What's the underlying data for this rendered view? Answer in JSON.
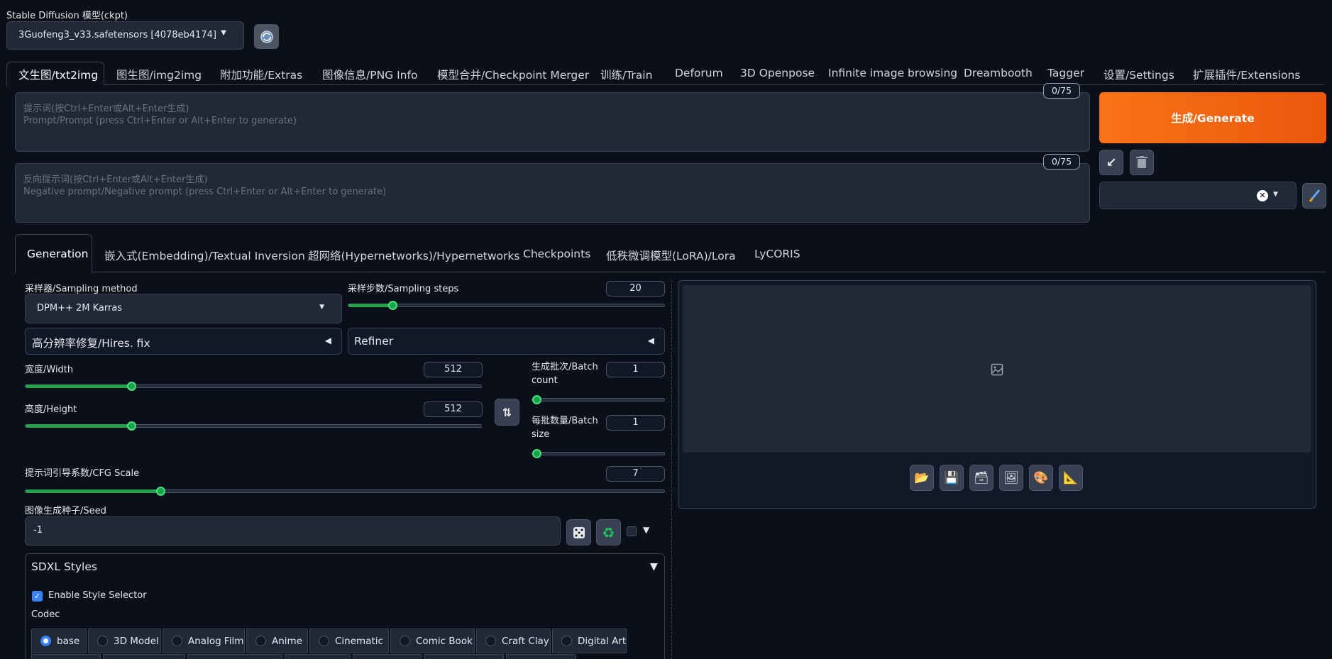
{
  "model": {
    "label": "Stable Diffusion 模型(ckpt)",
    "selected": "3Guofeng3_v33.safetensors [4078eb4174]"
  },
  "tabs": [
    "文生图/txt2img",
    "图生图/img2img",
    "附加功能/Extras",
    "图像信息/PNG Info",
    "模型合并/Checkpoint Merger",
    "训练/Train",
    "Deforum",
    "3D Openpose",
    "Infinite image browsing",
    "Dreambooth",
    "Tagger",
    "设置/Settings",
    "扩展插件/Extensions"
  ],
  "prompt": {
    "placeholder_line1": "提示词(按Ctrl+Enter或Alt+Enter生成)",
    "placeholder_line2": "Prompt/Prompt (press Ctrl+Enter or Alt+Enter to generate)",
    "token_count": "0/75"
  },
  "negative_prompt": {
    "placeholder_line1": "反向提示词(按Ctrl+Enter或Alt+Enter生成)",
    "placeholder_line2": "Negative prompt/Negative prompt (press Ctrl+Enter or Alt+Enter to generate)",
    "token_count": "0/75"
  },
  "generate_label": "生成/Generate",
  "subtabs": [
    "Generation",
    "嵌入式(Embedding)/Textual Inversion",
    "超网络(Hypernetworks)/Hypernetworks",
    "Checkpoints",
    "低秩微调模型(LoRA)/Lora",
    "LyCORIS"
  ],
  "sampler": {
    "label": "采样器/Sampling method",
    "value": "DPM++ 2M Karras"
  },
  "steps": {
    "label": "采样步数/Sampling steps",
    "value": "20",
    "min": 1,
    "max": 150
  },
  "hires_label": "高分辨率修复/Hires. fix",
  "refiner_label": "Refiner",
  "width": {
    "label": "宽度/Width",
    "value": "512",
    "min": 64,
    "max": 2048
  },
  "height": {
    "label": "高度/Height",
    "value": "512",
    "min": 64,
    "max": 2048
  },
  "batch_count": {
    "label": "生成批次/Batch count",
    "value": "1"
  },
  "batch_size": {
    "label": "每批数量/Batch size",
    "value": "1"
  },
  "cfg": {
    "label": "提示词引导系数/CFG Scale",
    "value": "7",
    "min": 1,
    "max": 30
  },
  "seed": {
    "label": "图像生成种子/Seed",
    "value": "-1"
  },
  "sdxl": {
    "title": "SDXL Styles",
    "enable_label": "Enable Style Selector",
    "codec_label": "Codec",
    "styles": [
      "base",
      "3D Model",
      "Analog Film",
      "Anime",
      "Cinematic",
      "Comic Book",
      "Craft Clay",
      "Digital Art"
    ],
    "selected": "base"
  },
  "colors": {
    "background": "#0b0f19",
    "accent_orange": "#f0642a",
    "slider_green": "#22a34b",
    "checkbox_blue": "#3b82f6"
  }
}
